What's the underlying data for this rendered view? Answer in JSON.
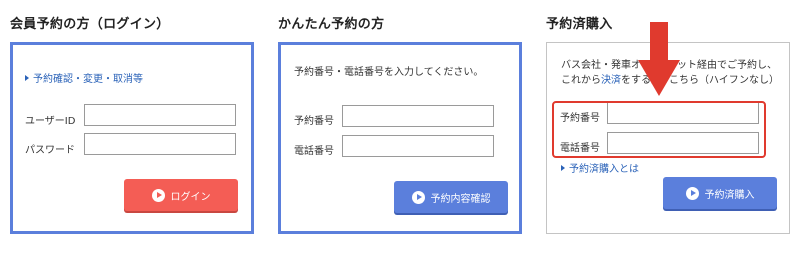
{
  "member": {
    "title": "会員予約の方（ログイン）",
    "link": "予約確認・変更・取消等",
    "userid_label": "ユーザーID",
    "password_label": "パスワード",
    "login_button": "ログイン"
  },
  "easy": {
    "title": "かんたん予約の方",
    "instruction": "予約番号・電話番号を入力してください。",
    "reservation_label": "予約番号",
    "phone_label": "電話番号",
    "confirm_button": "予約内容確認"
  },
  "purchased": {
    "title": "予約済購入",
    "desc_line1": "バス会社・発車オ",
    "desc_line1_tail": "ット経由でご予約し、",
    "desc_line2_a": "これから",
    "desc_line2_link": "決済",
    "desc_line2_b": "をする方",
    "desc_line2_c": "こちら（ハイフンなし）",
    "reservation_label": "予約番号",
    "phone_label": "電話番号",
    "link": "予約済購入とは",
    "purchase_button": "予約済購入"
  },
  "colors": {
    "accent_blue": "#5b7fdc",
    "login_red": "#f45d55",
    "highlight_red": "#e03a2e"
  }
}
